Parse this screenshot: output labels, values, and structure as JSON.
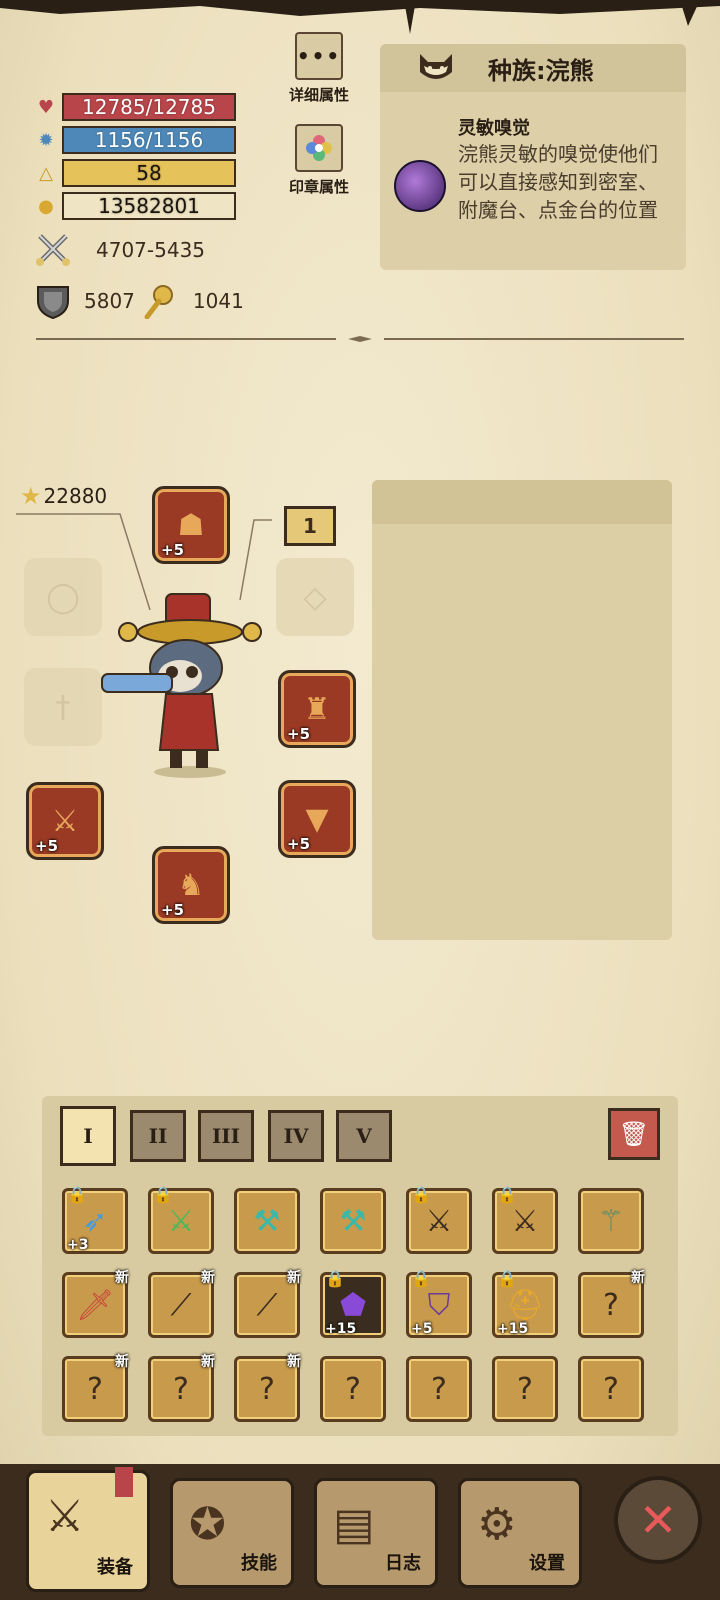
{
  "stats": {
    "hp": "12785/12785",
    "mp": "1156/1156",
    "level": "58",
    "gold": "13582801",
    "attack": "4707-5435",
    "defense": "5807",
    "magic": "1041"
  },
  "buttons": {
    "detail": "详细属性",
    "seal": "印章属性"
  },
  "race": {
    "title": "种族:浣熊",
    "trait_name": "灵敏嗅觉",
    "trait_desc": "浣熊灵敏的嗅觉使他们可以直接感知到密室、附魔台、点金台的位置"
  },
  "equipment": {
    "power": "22880",
    "count": "1",
    "slots": [
      {
        "name": "helmet",
        "plus": "+5"
      },
      {
        "name": "armor",
        "plus": "+5"
      },
      {
        "name": "weapon",
        "plus": "+5"
      },
      {
        "name": "legs",
        "plus": "+5"
      },
      {
        "name": "boots",
        "plus": "+5"
      }
    ]
  },
  "inventory": {
    "tabs": [
      "I",
      "II",
      "III",
      "IV",
      "V"
    ],
    "new_label": "新",
    "items_row1_levels": [
      "+3"
    ],
    "items_row2_levels": [
      "+15",
      "+5",
      "+15"
    ]
  },
  "nav": {
    "equip": "装备",
    "skills": "技能",
    "log": "日志",
    "settings": "设置"
  },
  "colors": {
    "hp": "#b8454a",
    "mp": "#4d88b8",
    "level": "#e5c25a",
    "close": "#e85a5a"
  }
}
